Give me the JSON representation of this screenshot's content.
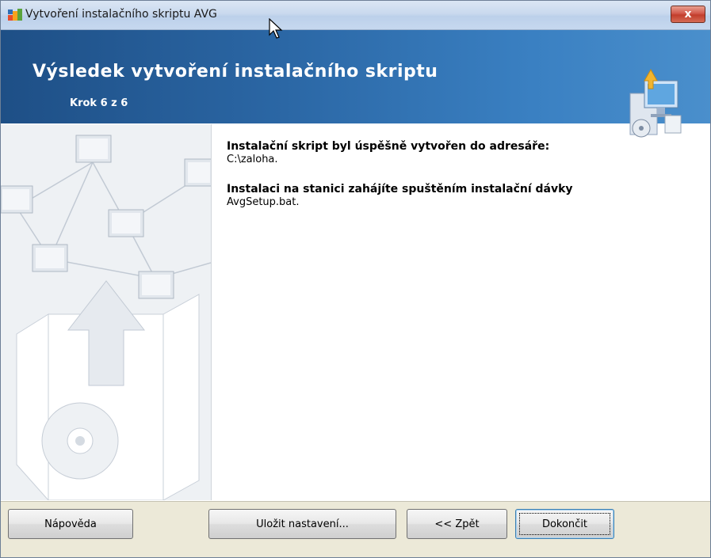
{
  "window": {
    "title": "Vytvoření instalačního skriptu AVG",
    "close_label": "x"
  },
  "banner": {
    "title": "Výsledek vytvoření instalačního skriptu",
    "step": "Krok 6 z 6"
  },
  "content": {
    "line1_title": "Instalační skript byl úspěšně vytvořen do adresáře:",
    "line1_value": "C:\\zaloha.",
    "line2_title": "Instalaci na stanici zahájíte spuštěním instalační dávky",
    "line2_value": "AvgSetup.bat."
  },
  "footer": {
    "help_label": "Nápověda",
    "save_label": "Uložit nastavení...",
    "back_label": "<< Zpět",
    "finish_label": "Dokončit"
  },
  "colors": {
    "banner": "#2b67a5",
    "titlebar": "#c9d9ee",
    "close": "#c23d2b",
    "footer": "#ece9d8"
  },
  "icons": [
    "avg-app-icon",
    "close-icon",
    "setup-computer-icon",
    "network-illustration",
    "mouse-cursor-icon"
  ]
}
